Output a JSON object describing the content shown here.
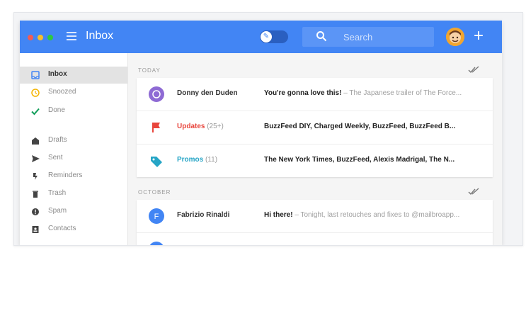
{
  "app": {
    "title": "Inbox"
  },
  "colors": {
    "topbar": "#4285f4",
    "updates": "#e8453c",
    "promos": "#26a5c6"
  },
  "search": {
    "placeholder": "Search"
  },
  "sidebar": {
    "items": [
      {
        "label": "Inbox",
        "icon": "inbox-icon"
      },
      {
        "label": "Snoozed",
        "icon": "clock-icon"
      },
      {
        "label": "Done",
        "icon": "check-icon"
      },
      {
        "label": "Drafts",
        "icon": "drafts-icon"
      },
      {
        "label": "Sent",
        "icon": "send-icon"
      },
      {
        "label": "Reminders",
        "icon": "reminder-icon"
      },
      {
        "label": "Trash",
        "icon": "trash-icon"
      },
      {
        "label": "Spam",
        "icon": "spam-icon"
      },
      {
        "label": "Contacts",
        "icon": "contacts-icon"
      }
    ]
  },
  "sections": [
    {
      "label": "TODAY",
      "rows": [
        {
          "sender": "Donny den Duden",
          "count": "",
          "subject": "You're gonna love this!",
          "snippet": " – The Japanese trailer of The Force..."
        },
        {
          "sender": "Updates",
          "count": " (25+)",
          "subject": "BuzzFeed DIY, Charged Weekly, BuzzFeed, BuzzFeed B...",
          "snippet": ""
        },
        {
          "sender": "Promos",
          "count": " (11)",
          "subject": "The New York Times, BuzzFeed, Alexis Madrigal, The N...",
          "snippet": ""
        }
      ]
    },
    {
      "label": "OCTOBER",
      "rows": [
        {
          "sender": "Fabrizio Rinaldi",
          "count": "",
          "subject": "Hi there!",
          "snippet": " – Tonight, last retouches and fixes to @mailbroapp..."
        }
      ]
    }
  ]
}
